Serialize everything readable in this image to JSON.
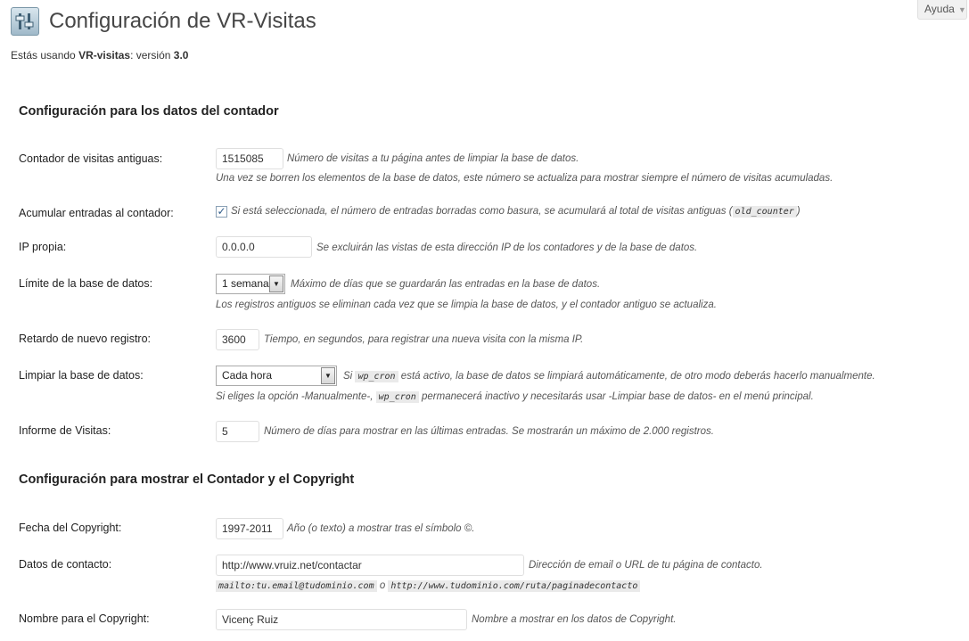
{
  "header": {
    "title": "Configuración de VR-Visitas",
    "help_label": "Ayuda",
    "version_prefix": "Estás usando ",
    "plugin_name": "VR-visitas",
    "version_middle": ": versión ",
    "version_number": "3.0"
  },
  "section1": {
    "title": "Configuración para los datos del contador",
    "old_counter": {
      "label": "Contador de visitas antiguas:",
      "value": "1515085",
      "desc1": "Número de visitas a tu página antes de limpiar la base de datos.",
      "desc2": "Una vez se borren los elementos de la base de datos, este número se actualiza para mostrar siempre el número de visitas acumuladas."
    },
    "accumulate": {
      "label": "Acumular entradas al contador:",
      "checked": true,
      "desc_before": "Si está seleccionada, el número de entradas borradas como basura, se acumulará al total de visitas antiguas (",
      "code": "old_counter",
      "desc_after": ")"
    },
    "own_ip": {
      "label": "IP propia:",
      "value": "0.0.0.0",
      "desc": "Se excluirán las vistas de esta dirección IP de los contadores y de la base de datos."
    },
    "db_limit": {
      "label": "Límite de la base de datos:",
      "selected": "1 semana",
      "desc1": "Máximo de días que se guardarán las entradas en la base de datos.",
      "desc2": "Los registros antiguos se eliminan cada vez que se limpia la base de datos, y el contador antiguo se actualiza."
    },
    "delay": {
      "label": "Retardo de nuevo registro:",
      "value": "3600",
      "desc": "Tiempo, en segundos, para registrar una nueva visita con la misma IP."
    },
    "cleanup": {
      "label": "Limpiar la base de datos:",
      "selected": "Cada hora",
      "desc1_before": "Si",
      "code": "wp_cron",
      "desc1_after": "está activo, la base de datos se limpiará automáticamente, de otro modo deberás hacerlo manualmente.",
      "desc2_before": "Si eliges la opción -Manualmente-,",
      "desc2_after": "permanecerá inactivo y necesitarás usar -Limpiar base de datos- en el menú principal."
    },
    "report": {
      "label": "Informe de Visitas:",
      "value": "5",
      "desc": "Número de días para mostrar en las últimas entradas. Se mostrarán un máximo de 2.000 registros."
    }
  },
  "section2": {
    "title": "Configuración para mostrar el Contador y el Copyright",
    "copyright_date": {
      "label": "Fecha del Copyright:",
      "value": "1997-2011",
      "desc": "Año (o texto) a mostrar tras el símbolo ©."
    },
    "contact": {
      "label": "Datos de contacto:",
      "value": "http://www.vruiz.net/contactar",
      "desc": "Dirección de email o URL de tu página de contacto.",
      "example1": "mailto:tu.email@tudominio.com",
      "or": "o",
      "example2": "http://www.tudominio.com/ruta/paginadecontacto"
    },
    "copyright_name": {
      "label": "Nombre para el Copyright:",
      "value": "Vicenç Ruiz",
      "desc": "Nombre a mostrar en los datos de Copyright."
    }
  }
}
